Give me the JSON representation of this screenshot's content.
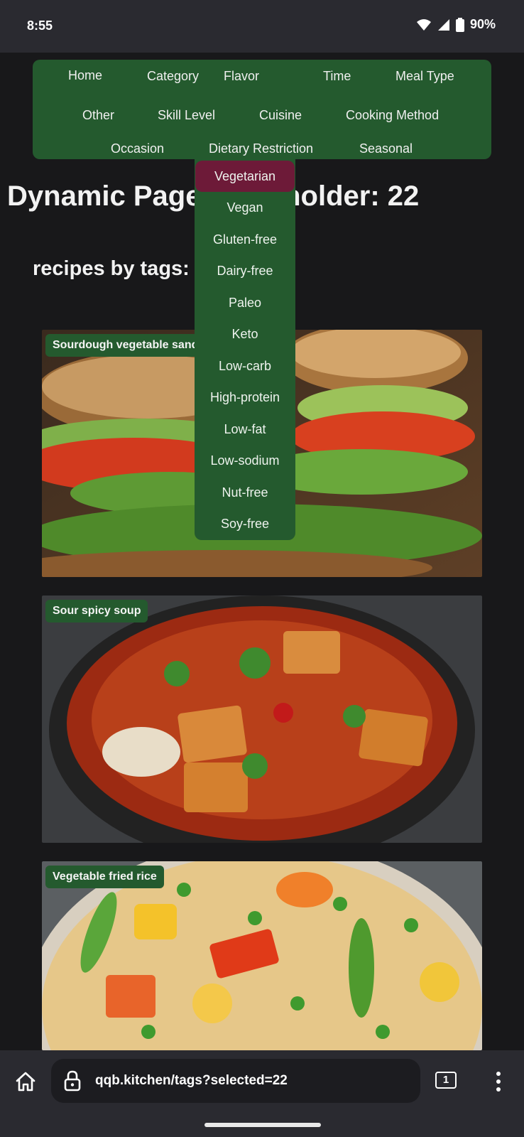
{
  "status_bar": {
    "time": "8:55",
    "battery": "90%"
  },
  "nav": {
    "items": [
      "Home",
      "Category",
      "Flavor",
      "Time",
      "Meal Type",
      "Other",
      "Skill Level",
      "Cuisine",
      "Cooking Method",
      "Occasion",
      "Dietary Restriction",
      "Seasonal"
    ]
  },
  "dropdown": {
    "items": [
      "Vegetarian",
      "Vegan",
      "Gluten-free",
      "Dairy-free",
      "Paleo",
      "Keto",
      "Low-carb",
      "High-protein",
      "Low-fat",
      "Low-sodium",
      "Nut-free",
      "Soy-free"
    ],
    "selected": "Vegetarian"
  },
  "page": {
    "title": "Dynamic Page Placeholder: 22",
    "title_left": "Dynamic Page",
    "title_right": "older: 22",
    "subtitle": "recipes by tags:"
  },
  "recipes": [
    {
      "name": "Sourdough vegetable sandwich",
      "visible_label": "Sourdough vegetable sandw"
    },
    {
      "name": "Sour spicy soup",
      "visible_label": "Sour spicy soup"
    },
    {
      "name": "Vegetable fried rice",
      "visible_label": "Vegetable fried rice"
    }
  ],
  "browser": {
    "url": "qqb.kitchen/tags?selected=22",
    "tab_count": "1"
  },
  "colors": {
    "nav_green": "#245a2e",
    "selected_maroon": "#6d1a38",
    "background": "#18181a"
  }
}
